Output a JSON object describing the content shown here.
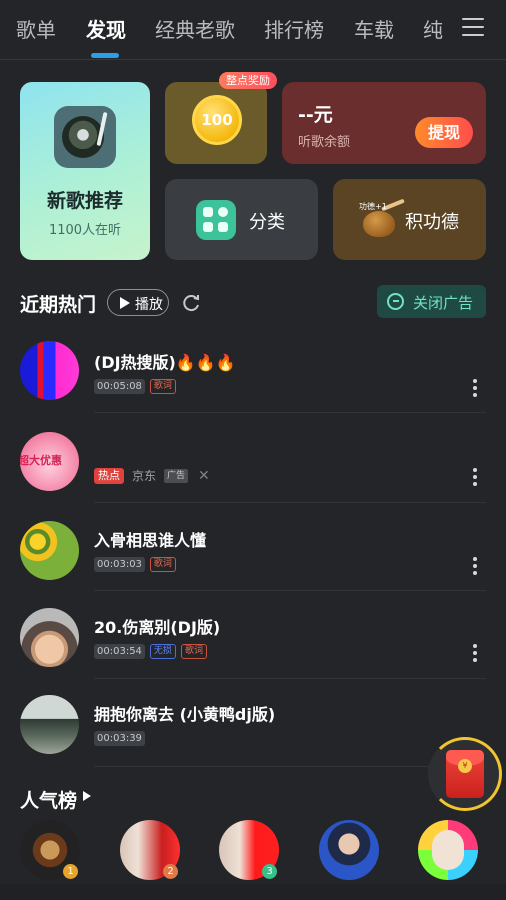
{
  "tabs": [
    {
      "label": "歌单",
      "active": false
    },
    {
      "label": "发现",
      "active": true
    },
    {
      "label": "经典老歌",
      "active": false
    },
    {
      "label": "排行榜",
      "active": false
    },
    {
      "label": "车载",
      "active": false
    },
    {
      "label": "纯",
      "active": false
    }
  ],
  "cards": {
    "new_songs": {
      "title": "新歌推荐",
      "subtitle": "1100人在听"
    },
    "coin": {
      "badge": "整点奖励",
      "value": "100"
    },
    "balance": {
      "amount": "--元",
      "label": "听歌余额",
      "withdraw": "提现"
    },
    "category": {
      "label": "分类"
    },
    "merit": {
      "label": "积功德",
      "icon_text": "功德+1"
    }
  },
  "recent": {
    "title": "近期热门",
    "play_label": "播放",
    "close_ad": "关闭广告"
  },
  "songs": [
    {
      "title": "(DJ热搜版)🔥🔥🔥",
      "duration": "00:05:08",
      "tags": [
        "歌词"
      ]
    },
    {
      "title": "",
      "hot": "热点",
      "source": "京东",
      "ad": "广告",
      "cover_text": "超大优惠"
    },
    {
      "title": "入骨相思谁人懂",
      "duration": "00:03:03",
      "tags": [
        "歌词"
      ]
    },
    {
      "title": "20.伤离别(DJ版)",
      "duration": "00:03:54",
      "tags": [
        "无损",
        "歌词"
      ]
    },
    {
      "title": "拥抱你离去 (小黄鸭dj版)",
      "duration": "00:03:39",
      "tags": []
    }
  ],
  "popular": {
    "title": "人气榜",
    "ranks": [
      "1",
      "2",
      "3"
    ]
  },
  "red_packet_symbol": "¥",
  "colors": {
    "accent": "#2a9ee8",
    "hot": "#e0433d",
    "mint": "#6fe3c4"
  }
}
